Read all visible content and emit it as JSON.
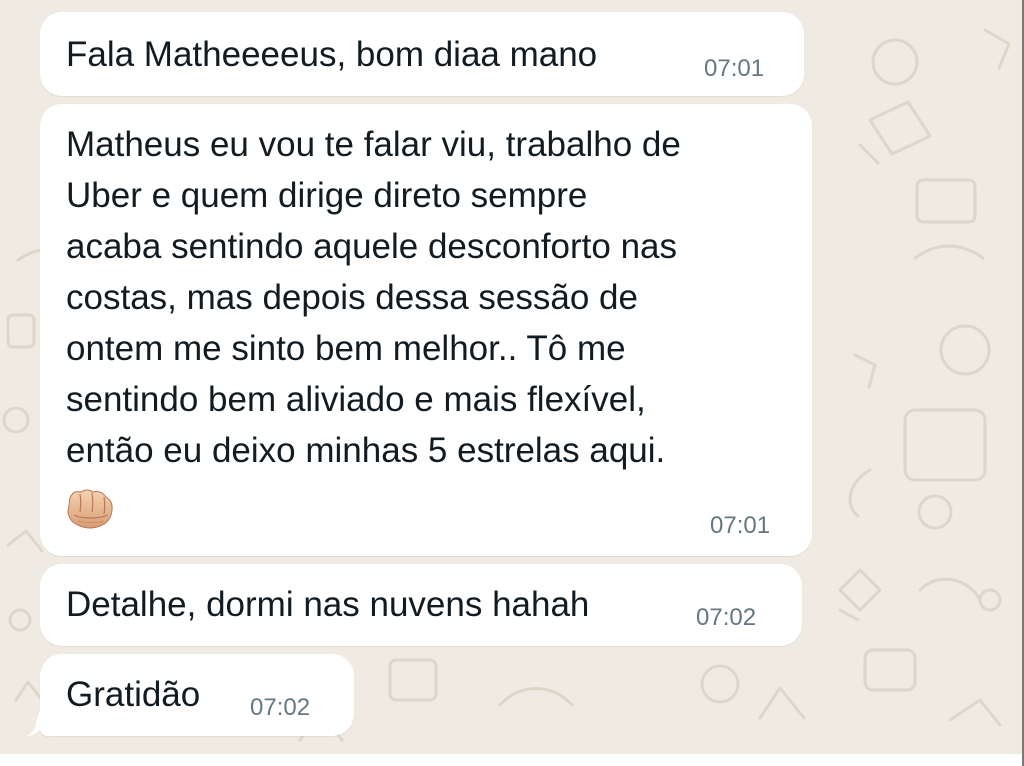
{
  "chat": {
    "messages": [
      {
        "text": "Fala Matheeeeus, bom diaa mano",
        "time": "07:01"
      },
      {
        "text": "Matheus eu vou te falar viu, trabalho de\nUber e quem dirige direto sempre\nacaba sentindo aquele desconforto nas\ncostas, mas depois dessa sessão de\nontem me sinto bem melhor.. Tô me\nsentindo bem aliviado e mais flexível,\nentão eu deixo minhas 5 estrelas aqui.",
        "emoji": "fist-bump-emoji",
        "time": "07:01"
      },
      {
        "text": "Detalhe, dormi nas nuvens hahah",
        "time": "07:02"
      },
      {
        "text": "Gratidão",
        "time": "07:02"
      }
    ]
  },
  "colors": {
    "chat_background": "#efeae2",
    "bubble": "#ffffff",
    "message_text": "#111b21",
    "timestamp": "#667781"
  }
}
